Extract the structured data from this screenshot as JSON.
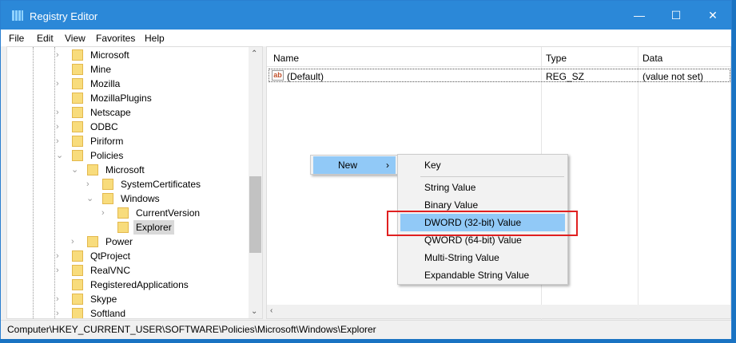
{
  "window": {
    "title": "Registry Editor",
    "minimize": "—",
    "maximize": "☐",
    "close": "✕"
  },
  "menubar": [
    "File",
    "Edit",
    "View",
    "Favorites",
    "Help"
  ],
  "tree": [
    {
      "label": "Microsoft",
      "level": 0,
      "expander": "collapsed"
    },
    {
      "label": "Mine",
      "level": 0,
      "expander": "none"
    },
    {
      "label": "Mozilla",
      "level": 0,
      "expander": "collapsed"
    },
    {
      "label": "MozillaPlugins",
      "level": 0,
      "expander": "none"
    },
    {
      "label": "Netscape",
      "level": 0,
      "expander": "collapsed"
    },
    {
      "label": "ODBC",
      "level": 0,
      "expander": "collapsed"
    },
    {
      "label": "Piriform",
      "level": 0,
      "expander": "collapsed"
    },
    {
      "label": "Policies",
      "level": 0,
      "expander": "expanded"
    },
    {
      "label": "Microsoft",
      "level": 1,
      "expander": "expanded"
    },
    {
      "label": "SystemCertificates",
      "level": 2,
      "expander": "collapsed"
    },
    {
      "label": "Windows",
      "level": 2,
      "expander": "expanded"
    },
    {
      "label": "CurrentVersion",
      "level": 3,
      "expander": "collapsed"
    },
    {
      "label": "Explorer",
      "level": 3,
      "expander": "none",
      "selected": true
    },
    {
      "label": "Power",
      "level": 1,
      "expander": "collapsed"
    },
    {
      "label": "QtProject",
      "level": 0,
      "expander": "collapsed"
    },
    {
      "label": "RealVNC",
      "level": 0,
      "expander": "collapsed"
    },
    {
      "label": "RegisteredApplications",
      "level": 0,
      "expander": "none"
    },
    {
      "label": "Skype",
      "level": 0,
      "expander": "collapsed"
    },
    {
      "label": "Softland",
      "level": 0,
      "expander": "collapsed"
    }
  ],
  "values": {
    "headers": {
      "name": "Name",
      "type": "Type",
      "data": "Data"
    },
    "rows": [
      {
        "icon": "ab",
        "name": "(Default)",
        "type": "REG_SZ",
        "data": "(value not set)"
      }
    ]
  },
  "context_menu": {
    "new_label": "New",
    "arrow": "›",
    "submenu": [
      "Key",
      "String Value",
      "Binary Value",
      "DWORD (32-bit) Value",
      "QWORD (64-bit) Value",
      "Multi-String Value",
      "Expandable String Value"
    ],
    "highlighted": "DWORD (32-bit) Value"
  },
  "status": "Computer\\HKEY_CURRENT_USER\\SOFTWARE\\Policies\\Microsoft\\Windows\\Explorer"
}
